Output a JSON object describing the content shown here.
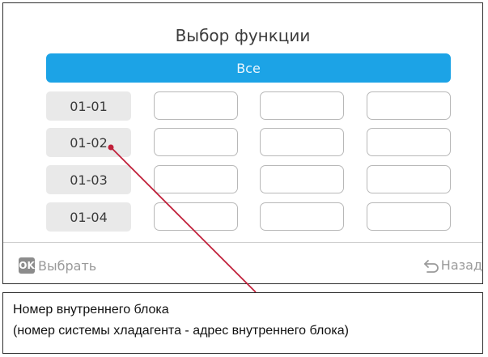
{
  "screen": {
    "title": "Выбор функции",
    "all_button_label": "Все",
    "units": [
      {
        "label": "01-01"
      },
      {
        "label": "01-02"
      },
      {
        "label": "01-03"
      },
      {
        "label": "01-04"
      }
    ],
    "footer": {
      "ok_badge": "OK",
      "ok_label": "Выбрать",
      "back_label": "Назад",
      "back_icon": "return-arrow-icon"
    }
  },
  "callout": {
    "line1": "Номер внутреннего блока",
    "line2": "(номер системы хладагента - адрес внутреннего блока)"
  },
  "colors": {
    "accent": "#1ca3e6",
    "leader_line": "#c0203a",
    "label_bg": "#e9e9e9",
    "cell_border": "#b8b8b8"
  }
}
